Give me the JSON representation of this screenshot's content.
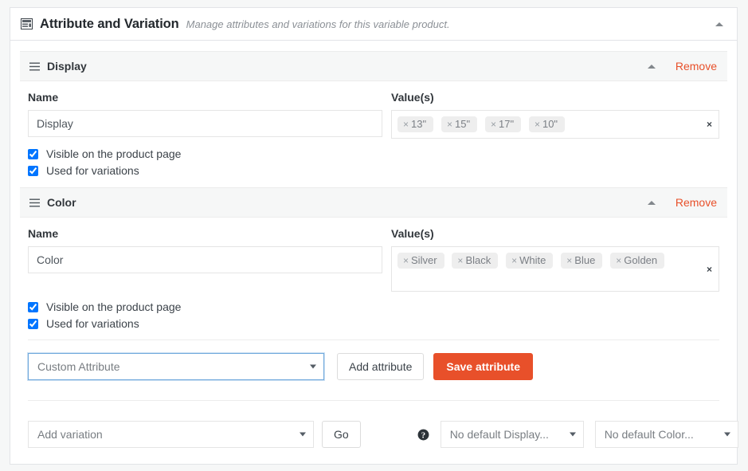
{
  "panel": {
    "title": "Attribute and Variation",
    "subtitle": "Manage attributes and variations for this variable product.",
    "title_icon": "list-table-icon",
    "collapse_icon": "caret-up-icon"
  },
  "labels": {
    "name": "Name",
    "values": "Value(s)",
    "visible_on_product_page": "Visible on the product page",
    "used_for_variations": "Used for variations",
    "remove": "Remove",
    "tag_remove_mark": "×",
    "clear_mark": "×"
  },
  "attributes": [
    {
      "heading": "Display",
      "name_value": "Display",
      "values": [
        "13\"",
        "15\"",
        "17\""
      ],
      "values_all": [
        "13\"",
        "15\"",
        "17\"",
        "10\""
      ],
      "visible_checked": true,
      "used_for_variations_checked": true
    },
    {
      "heading": "Color",
      "name_value": "Color",
      "values_all": [
        "Silver",
        "Black",
        "White",
        "Blue",
        "Golden"
      ],
      "visible_checked": true,
      "used_for_variations_checked": true
    }
  ],
  "attribute_actions": {
    "custom_attribute_select": "Custom Attribute",
    "add_attribute_button": "Add attribute",
    "save_attribute_button": "Save attribute"
  },
  "variation_actions": {
    "add_variation_select": "Add variation",
    "go_button": "Go",
    "help_icon": "question-mark-icon",
    "default_display_select": "No default Display...",
    "default_color_select": "No default Color..."
  },
  "colors": {
    "accent": "#e8502a",
    "panel_border": "#e2e4e7",
    "section_bg": "#f6f7f7",
    "tag_bg": "#eeeeee",
    "focus_border": "#6fa8dc"
  }
}
